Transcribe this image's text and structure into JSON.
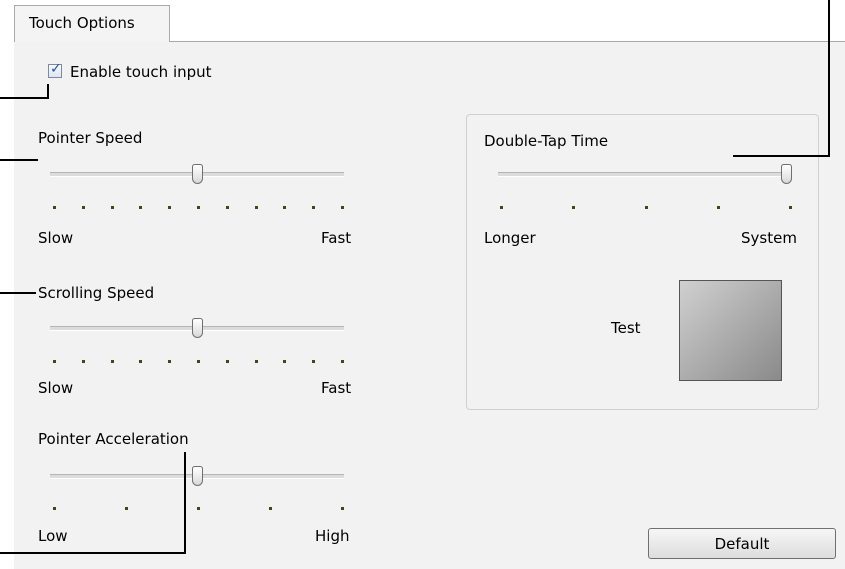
{
  "tab": {
    "label": "Touch Options"
  },
  "enable_touch": {
    "label": "Enable touch input",
    "checked": true
  },
  "pointer_speed": {
    "title": "Pointer Speed",
    "min_label": "Slow",
    "max_label": "Fast",
    "level": 0.5,
    "ticks": 11
  },
  "scrolling_speed": {
    "title": "Scrolling Speed",
    "min_label": "Slow",
    "max_label": "Fast",
    "level": 0.5,
    "ticks": 11
  },
  "pointer_acceleration": {
    "title": "Pointer Acceleration",
    "min_label": "Low",
    "max_label": "High",
    "level": 0.5,
    "ticks": 5
  },
  "double_tap": {
    "title": "Double-Tap Time",
    "min_label": "Longer",
    "max_label": "System",
    "level": 1.0,
    "ticks": 5
  },
  "test": {
    "label": "Test"
  },
  "default_button": {
    "label": "Default"
  },
  "colors": {
    "panel": "#f2f2f2",
    "tick": "#3c4a13",
    "check": "#2a4fb0"
  }
}
